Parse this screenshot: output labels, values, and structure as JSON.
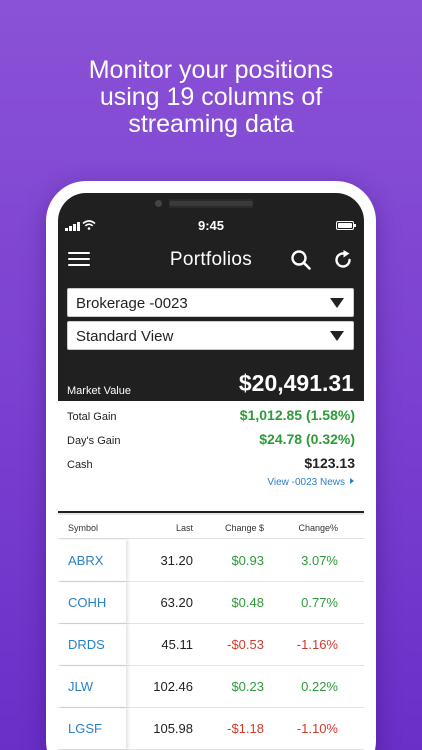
{
  "headline": [
    "Monitor your positions",
    "using 19 columns of",
    "streaming data"
  ],
  "status_bar": {
    "time": "9:45"
  },
  "header": {
    "title": "Portfolios"
  },
  "account_select": {
    "value": "Brokerage -0023"
  },
  "view_select": {
    "value": "Standard View"
  },
  "market": {
    "label": "Market Value",
    "value": "$20,491.31"
  },
  "summary": {
    "total_gain": {
      "label": "Total Gain",
      "value": "$1,012.85 (1.58%)"
    },
    "days_gain": {
      "label": "Day's Gain",
      "value": "$24.78 (0.32%)"
    },
    "cash": {
      "label": "Cash",
      "value": "$123.13"
    }
  },
  "news_link": "View -0023 News",
  "table": {
    "columns": [
      "Symbol",
      "Last",
      "Change $",
      "Change%"
    ],
    "rows": [
      {
        "symbol": "ABRX",
        "last": "31.20",
        "change": "$0.93",
        "pct": "3.07%",
        "dir": "up"
      },
      {
        "symbol": "COHH",
        "last": "63.20",
        "change": "$0.48",
        "pct": "0.77%",
        "dir": "up"
      },
      {
        "symbol": "DRDS",
        "last": "45.11",
        "change": "-$0.53",
        "pct": "-1.16%",
        "dir": "down"
      },
      {
        "symbol": "JLW",
        "last": "102.46",
        "change": "$0.23",
        "pct": "0.22%",
        "dir": "up"
      },
      {
        "symbol": "LGSF",
        "last": "105.98",
        "change": "-$1.18",
        "pct": "-1.10%",
        "dir": "down"
      }
    ]
  },
  "icons": [
    "menu-icon",
    "search-icon",
    "refresh-icon",
    "signal-icon",
    "wifi-icon",
    "battery-icon",
    "caret-down-icon"
  ],
  "colors": {
    "background": "#7a3fd0",
    "gain": "#2e9a3a",
    "loss": "#d23a2e",
    "link": "#2a7fc8"
  }
}
